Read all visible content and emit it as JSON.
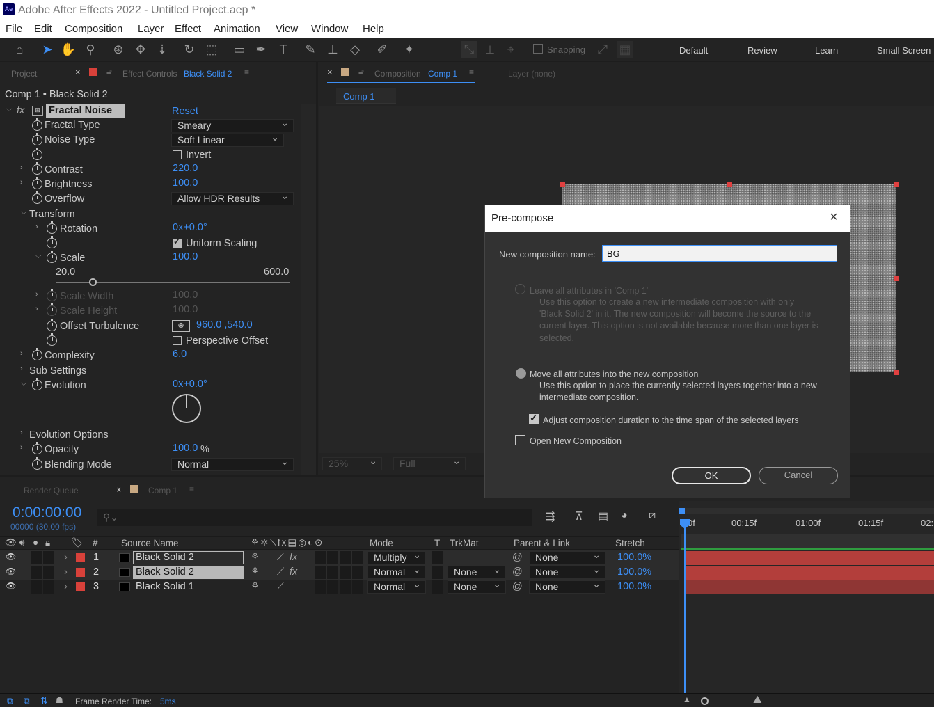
{
  "app": {
    "title": "Adobe After Effects 2022 - Untitled Project.aep *",
    "logo": "Ae"
  },
  "menu": [
    "File",
    "Edit",
    "Composition",
    "Layer",
    "Effect",
    "Animation",
    "View",
    "Window",
    "Help"
  ],
  "toolbar": {
    "snapping": "Snapping",
    "workspaces": [
      "Default",
      "Review",
      "Learn",
      "Small Screen"
    ]
  },
  "left_panel": {
    "tab_project": "Project",
    "tab_effect_controls": "Effect Controls",
    "effect_layer": "Black Solid 2",
    "breadcrumb": "Comp 1 • Black Solid 2",
    "effect_name": "Fractal Noise",
    "reset": "Reset",
    "props": {
      "fractal_type": "Fractal Type",
      "fractal_type_val": "Smeary",
      "noise_type": "Noise Type",
      "noise_type_val": "Soft Linear",
      "invert": "Invert",
      "contrast": "Contrast",
      "contrast_val": "220.0",
      "brightness": "Brightness",
      "brightness_val": "100.0",
      "overflow": "Overflow",
      "overflow_val": "Allow HDR Results",
      "transform": "Transform",
      "rotation": "Rotation",
      "rotation_val": "0x+0.0°",
      "uniform_scaling": "Uniform Scaling",
      "scale": "Scale",
      "scale_val": "100.0",
      "scale_min": "20.0",
      "scale_max": "600.0",
      "scale_width": "Scale Width",
      "scale_width_val": "100.0",
      "scale_height": "Scale Height",
      "scale_height_val": "100.0",
      "offset_turbulence": "Offset Turbulence",
      "offset_val": "960.0 ,540.0",
      "perspective_offset": "Perspective Offset",
      "complexity": "Complexity",
      "complexity_val": "6.0",
      "sub_settings": "Sub Settings",
      "evolution": "Evolution",
      "evolution_val": "0x+0.0°",
      "evolution_options": "Evolution Options",
      "opacity": "Opacity",
      "opacity_val": "100.0",
      "opacity_unit": "%",
      "blending_mode": "Blending Mode",
      "blending_mode_val": "Normal"
    }
  },
  "comp_panel": {
    "tab": "Composition",
    "comp_name": "Comp 1",
    "layer_tab": "Layer (none)",
    "sub_tab": "Comp 1",
    "zoom": "25%",
    "resolution": "Full"
  },
  "dialog": {
    "title": "Pre-compose",
    "name_label": "New composition name:",
    "name_value": "BG",
    "opt1_label": "Leave all attributes in 'Comp 1'",
    "opt1_desc": [
      "Use this option to create a new intermediate composition with only",
      "'Black Solid 2' in it. The new composition will become the source to the",
      "current layer. This option is not available because more than one layer is",
      "selected."
    ],
    "opt2_label": "Move all attributes into the new composition",
    "opt2_desc": [
      "Use this option to place the currently selected layers together into a new",
      "intermediate composition."
    ],
    "adjust_label": "Adjust composition duration to the time span of the selected layers",
    "open_label": "Open New Composition",
    "ok": "OK",
    "cancel": "Cancel"
  },
  "timeline": {
    "tab_render": "Render Queue",
    "tab_comp": "Comp 1",
    "timecode": "0:00:00:00",
    "frames": "00000 (30.00 fps)",
    "headers": {
      "num": "#",
      "source": "Source Name",
      "mode": "Mode",
      "t": "T",
      "trkmat": "TrkMat",
      "parent": "Parent & Link",
      "stretch": "Stretch"
    },
    "ruler": [
      "0f",
      "00:15f",
      "01:00f",
      "01:15f",
      "02:"
    ],
    "layers": [
      {
        "num": "1",
        "name": "Black Solid 2",
        "mode": "Multiply",
        "trkmat": "",
        "parent": "None",
        "stretch": "100.0%",
        "fx": true
      },
      {
        "num": "2",
        "name": "Black Solid 2",
        "mode": "Normal",
        "trkmat": "None",
        "parent": "None",
        "stretch": "100.0%",
        "fx": true
      },
      {
        "num": "3",
        "name": "Black Solid 1",
        "mode": "Normal",
        "trkmat": "None",
        "parent": "None",
        "stretch": "100.0%",
        "fx": false
      }
    ],
    "status_label": "Frame Render Time:",
    "status_value": "5ms"
  },
  "colors": {
    "accent": "#3d8ff6",
    "label_red": "#d8413a",
    "bar": "#b33e3b"
  }
}
